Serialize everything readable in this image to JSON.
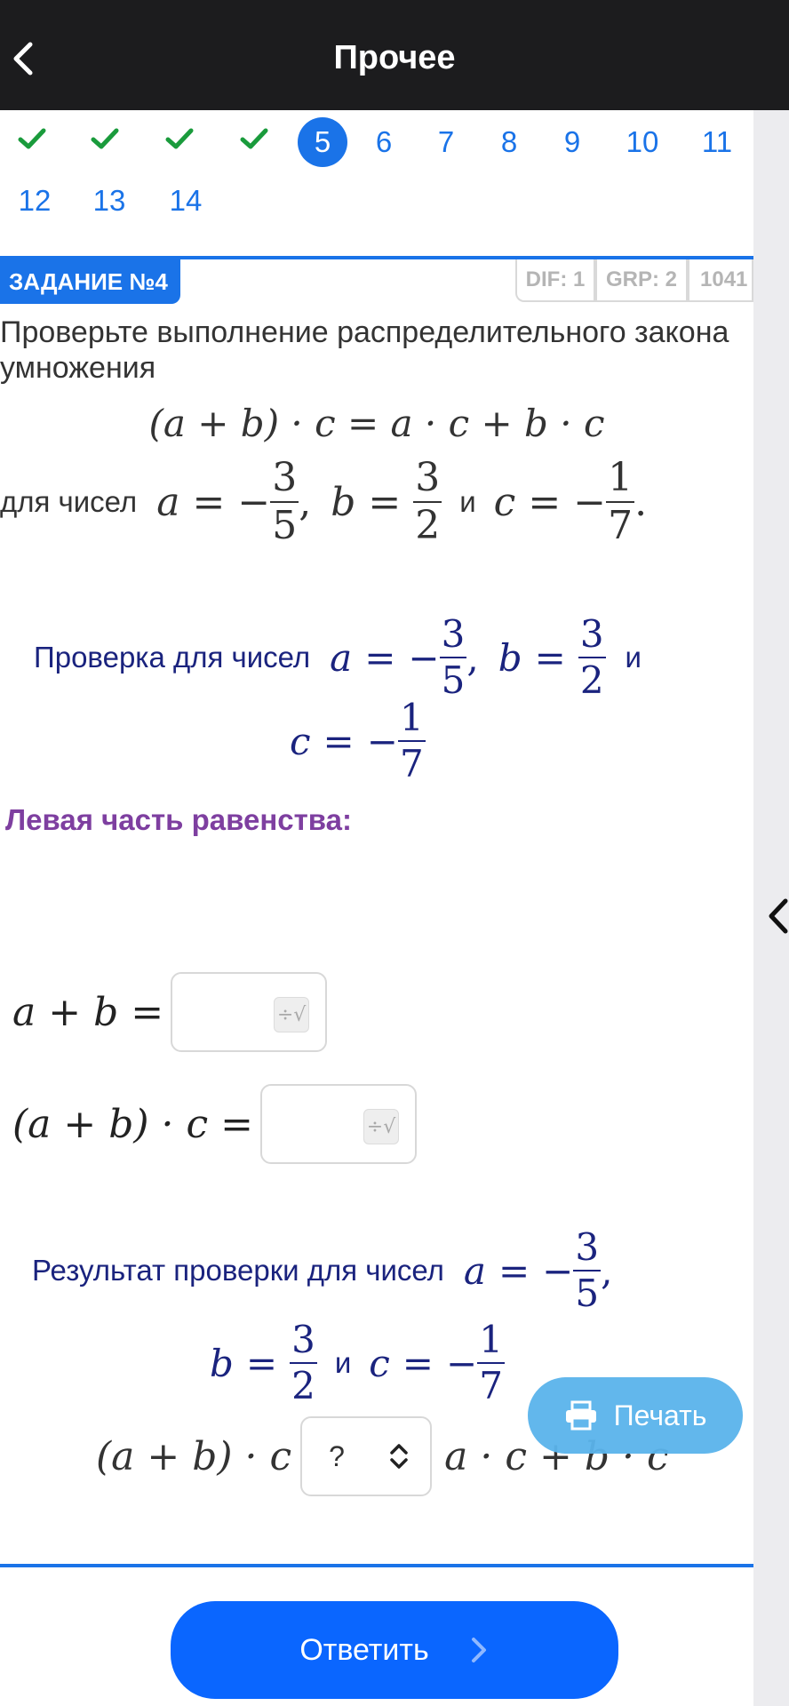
{
  "header": {
    "title": "Прочее"
  },
  "pager": {
    "done_count": 4,
    "active": "5",
    "pages": [
      "6",
      "7",
      "8",
      "9",
      "10",
      "11",
      "12",
      "13",
      "14"
    ]
  },
  "task": {
    "label": "ЗАДАНИЕ №4",
    "dif": "DIF: 1",
    "grp": "GRP: 2",
    "id": "1041",
    "statement": "Проверьте выполнение распределительного закона умножения",
    "formula": "(a + b) · c = a · c + b · c",
    "cond_prefix": "для чисел",
    "cond_and": "и",
    "a": {
      "sign": "−",
      "num": "3",
      "den": "5"
    },
    "b": {
      "num": "3",
      "den": "2"
    },
    "c": {
      "sign": "−",
      "num": "1",
      "den": "7"
    }
  },
  "check": {
    "title": "Проверка для чисел",
    "and": "и"
  },
  "left_part": {
    "heading": "Левая часть равенства:",
    "expr1": "a + b =",
    "expr2": "(a + b) · c =",
    "input1_value": "",
    "input2_value": ""
  },
  "result": {
    "title": "Результат проверки для чисел",
    "and": "и",
    "left_expr": "(a + b) · c",
    "select_value": "?",
    "right_expr": "a · c + b · c"
  },
  "buttons": {
    "print": "Печать",
    "answer": "Ответить"
  },
  "colors": {
    "accent": "#1a73e8",
    "check_green": "#1a9b3c",
    "purple_heading": "#7e3fa0",
    "math_navy": "#1a237e",
    "answer_button": "#0a66ff",
    "print_button": "#5ab4ec"
  }
}
